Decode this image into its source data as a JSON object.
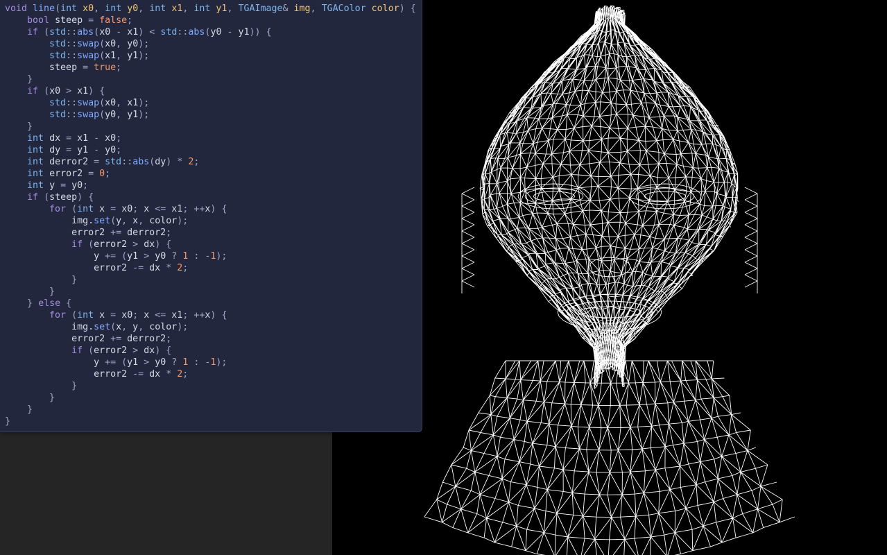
{
  "editor": {
    "code_lines": [
      "void line(int x0, int y0, int x1, int y1, TGAImage& img, TGAColor color) {",
      "    bool steep = false;",
      "    if (std::abs(x0 - x1) < std::abs(y0 - y1)) {",
      "        std::swap(x0, y0);",
      "        std::swap(x1, y1);",
      "        steep = true;",
      "    }",
      "    if (x0 > x1) {",
      "        std::swap(x0, x1);",
      "        std::swap(y0, y1);",
      "    }",
      "    int dx = x1 - x0;",
      "    int dy = y1 - y0;",
      "    int derror2 = std::abs(dy) * 2;",
      "    int error2 = 0;",
      "    int y = y0;",
      "    if (steep) {",
      "        for (int x = x0; x <= x1; ++x) {",
      "            img.set(y, x, color);",
      "            error2 += derror2;",
      "            if (error2 > dx) {",
      "                y += (y1 > y0 ? 1 : -1);",
      "                error2 -= dx * 2;",
      "            }",
      "        }",
      "    } else {",
      "        for (int x = x0; x <= x1; ++x) {",
      "            img.set(x, y, color);",
      "            error2 += derror2;",
      "            if (error2 > dx) {",
      "                y += (y1 > y0 ? 1 : -1);",
      "                error2 -= dx * 2;",
      "            }",
      "        }",
      "    }",
      "}"
    ]
  },
  "viewport": {
    "subject": "wireframe-head-mesh",
    "line_color": "#ffffff",
    "background_color": "#000000"
  },
  "colors": {
    "editor_bg": "#22273d",
    "keyword": "#a18ee0",
    "type": "#7db3ec",
    "function": "#82aaff",
    "param": "#f0c674",
    "number": "#f2996b"
  }
}
